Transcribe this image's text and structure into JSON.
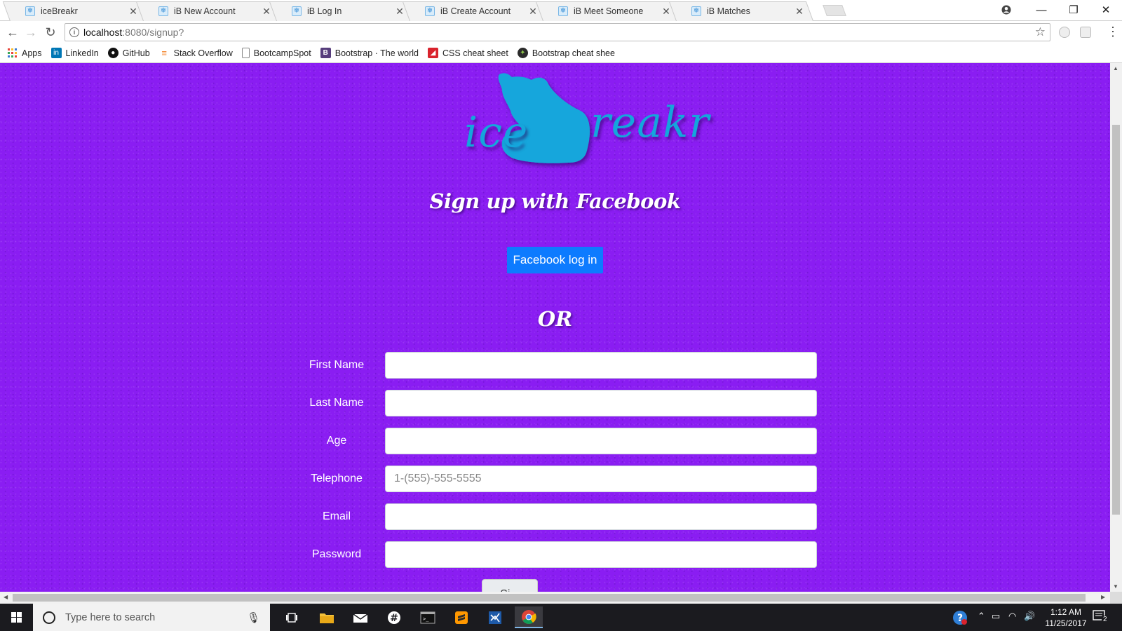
{
  "browser": {
    "tabs": [
      {
        "title": "iceBreakr",
        "active": false
      },
      {
        "title": "iB New Account",
        "active": true
      },
      {
        "title": "iB Log In",
        "active": false
      },
      {
        "title": "iB Create Account",
        "active": false
      },
      {
        "title": "iB Meet Someone",
        "active": false
      },
      {
        "title": "iB Matches",
        "active": false
      }
    ],
    "url_host": "localhost",
    "url_path": ":8080/signup?",
    "bookmarks": [
      {
        "label": "Apps",
        "icon": "apps-grid-icon",
        "color": "#e8453c"
      },
      {
        "label": "LinkedIn",
        "icon": "linkedin-icon",
        "color": "#0077b5"
      },
      {
        "label": "GitHub",
        "icon": "github-icon",
        "color": "#111111"
      },
      {
        "label": "Stack Overflow",
        "icon": "stackoverflow-icon",
        "color": "#f48024"
      },
      {
        "label": "BootcampSpot",
        "icon": "page-icon",
        "color": "#888888"
      },
      {
        "label": "Bootstrap · The world",
        "icon": "bootstrap-icon",
        "color": "#563d7c"
      },
      {
        "label": "CSS cheat sheet",
        "icon": "css-icon",
        "color": "#d9232d"
      },
      {
        "label": "Bootstrap cheat shee",
        "icon": "bootstrap-cheat-icon",
        "color": "#2a2a2a"
      }
    ]
  },
  "page": {
    "logo_left": "ice",
    "logo_right": "reakr",
    "fb_heading": "Sign up with Facebook",
    "fb_button": "Facebook log in",
    "or_heading": "OR",
    "form": {
      "fields": [
        {
          "label": "First Name",
          "placeholder": "",
          "value": ""
        },
        {
          "label": "Last Name",
          "placeholder": "",
          "value": ""
        },
        {
          "label": "Age",
          "placeholder": "",
          "value": ""
        },
        {
          "label": "Telephone",
          "placeholder": "1-(555)-555-5555",
          "value": ""
        },
        {
          "label": "Email",
          "placeholder": "",
          "value": ""
        },
        {
          "label": "Password",
          "placeholder": "",
          "value": ""
        }
      ],
      "submit_label": "Si..."
    },
    "colors": {
      "background": "#8a1df2",
      "logo": "#14a6dc",
      "fb_button": "#0d7bff"
    }
  },
  "taskbar": {
    "search_placeholder": "Type here to search",
    "time": "1:12 AM",
    "date": "11/25/2017",
    "notification_count": "2"
  }
}
